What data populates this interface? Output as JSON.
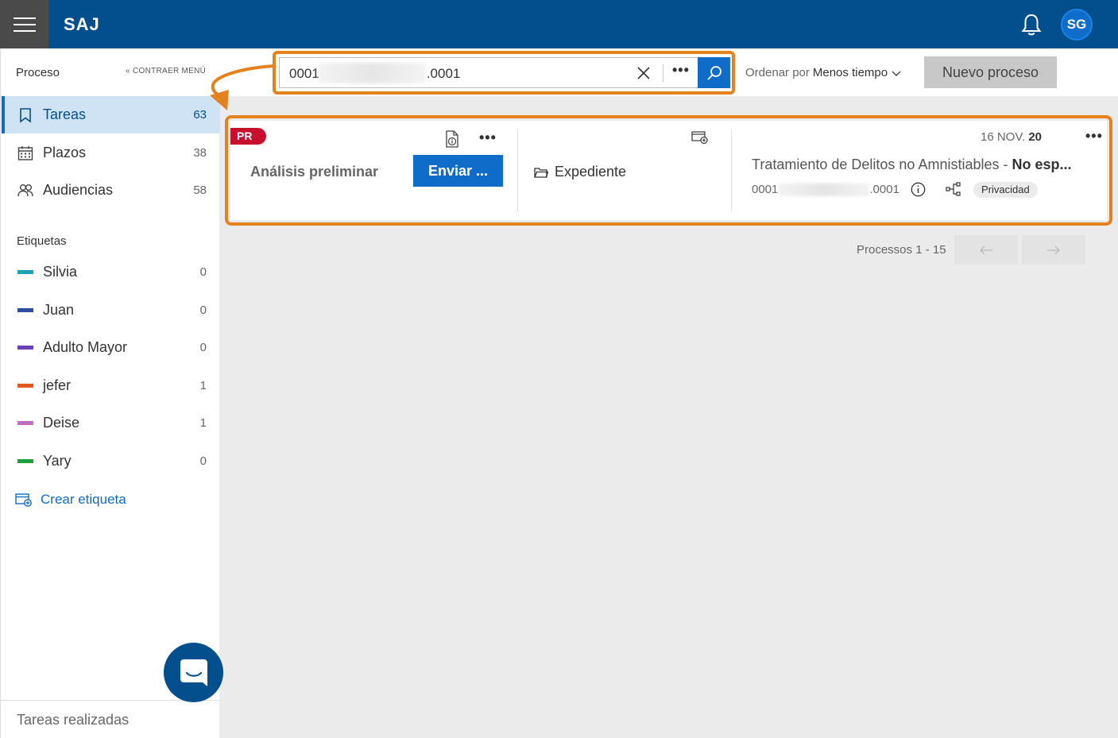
{
  "header": {
    "app_title": "SAJ",
    "avatar_initials": "SG",
    "bg_color": "#034f8e"
  },
  "sidebar": {
    "title": "Proceso",
    "collapse_label": "CONTRAER MENÚ",
    "nav_items": [
      {
        "label": "Tareas",
        "count": "63",
        "icon": "bookmark-icon",
        "active": true
      },
      {
        "label": "Plazos",
        "count": "38",
        "icon": "calendar-icon",
        "active": false
      },
      {
        "label": "Audiencias",
        "count": "58",
        "icon": "people-icon",
        "active": false
      }
    ],
    "tags_title": "Etiquetas",
    "tags": [
      {
        "label": "Silvia",
        "count": "0",
        "color": "#1aa3b0"
      },
      {
        "label": "Juan",
        "count": "0",
        "color": "#2b4fa0"
      },
      {
        "label": "Adulto Mayor",
        "count": "0",
        "color": "#6a3fb8"
      },
      {
        "label": "jefer",
        "count": "1",
        "color": "#e05a1e"
      },
      {
        "label": "Deise",
        "count": "1",
        "color": "#c070c0"
      },
      {
        "label": "Yary",
        "count": "0",
        "color": "#1f9e3e"
      }
    ],
    "create_tag_label": "Crear etiqueta",
    "footer_label": "Tareas realizadas"
  },
  "toolbar": {
    "search_prefix": "0001",
    "search_suffix": ".0001",
    "order_label": "Ordenar por",
    "order_value": "Menos tiempo",
    "new_process_label": "Nuevo proceso"
  },
  "card": {
    "badge": "PR",
    "task_name": "Análisis preliminar",
    "send_label": "Enviar ...",
    "folder_label": "Expediente",
    "date_day": "16 NOV.",
    "date_year": "20",
    "title_main": "Tratamiento de Delitos no Amnistiables - ",
    "title_bold": "No esp...",
    "num_prefix": "0001",
    "num_suffix": ".0001",
    "privacy_label": "Privacidad"
  },
  "pagination": {
    "label": "Processos 1 - 15"
  },
  "colors": {
    "accent": "#0f6cc9",
    "highlight": "#e6821e",
    "badge_red": "#c8102e"
  }
}
